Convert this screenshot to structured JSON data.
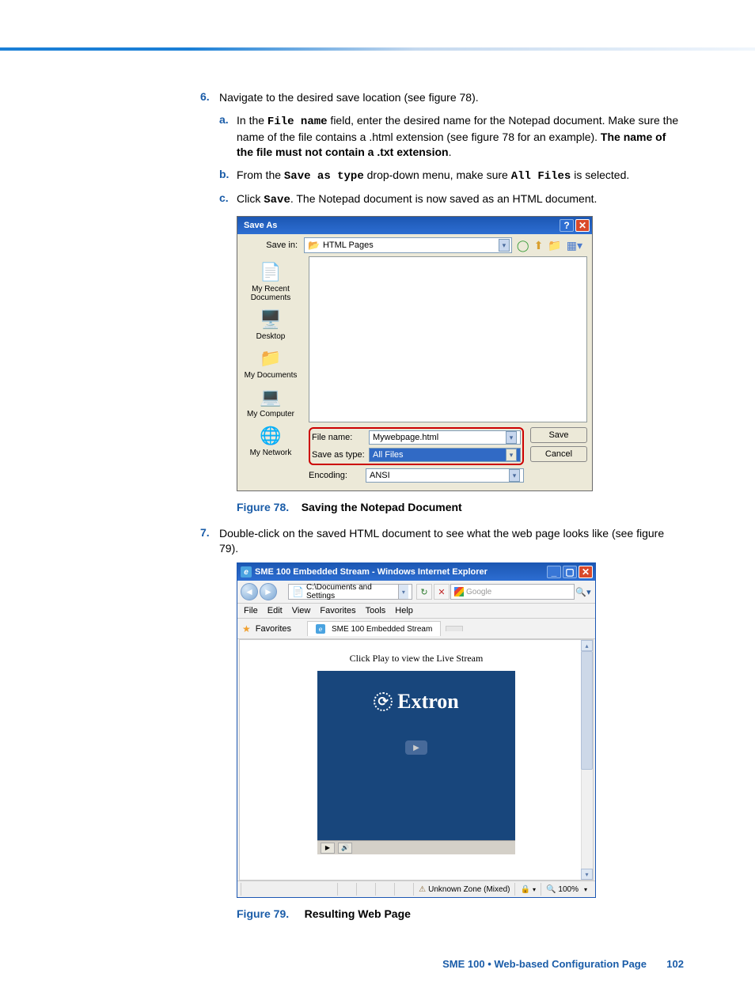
{
  "step6": {
    "num": "6.",
    "text": "Navigate to the desired save location (see figure 78).",
    "a": {
      "marker": "a.",
      "t1": "In the ",
      "code1": "File name",
      "t2": " field, enter the desired name for the Notepad document. Make sure the name of the file contains a .html extension (see figure 78 for an example). ",
      "bold": "The name of the file must not contain a .txt extension",
      "t3": "."
    },
    "b": {
      "marker": "b.",
      "t1": "From the ",
      "code1": "Save as type",
      "t2": " drop-down menu, make sure ",
      "code2": "All Files",
      "t3": " is selected."
    },
    "c": {
      "marker": "c.",
      "t1": "Click ",
      "code1": "Save",
      "t2": ". The Notepad document is now saved as an HTML document."
    }
  },
  "saveas": {
    "title": "Save As",
    "savein_label": "Save in:",
    "savein_value": "HTML Pages",
    "sidebar": [
      "My Recent Documents",
      "Desktop",
      "My Documents",
      "My Computer",
      "My Network"
    ],
    "filename_label": "File name:",
    "filename_value": "Mywebpage.html",
    "saveastype_label": "Save as type:",
    "saveastype_value": "All Files",
    "encoding_label": "Encoding:",
    "encoding_value": "ANSI",
    "save_btn": "Save",
    "cancel_btn": "Cancel"
  },
  "fig78": {
    "num": "Figure 78.",
    "title": "Saving the Notepad Document"
  },
  "step7": {
    "num": "7.",
    "text": "Double-click on the saved HTML document to see what the web page looks like (see figure 79)."
  },
  "ie": {
    "title": "SME 100 Embedded Stream - Windows Internet Explorer",
    "address": "C:\\Documents and Settings",
    "search": "Google",
    "menu": [
      "File",
      "Edit",
      "View",
      "Favorites",
      "Tools",
      "Help"
    ],
    "favorites": "Favorites",
    "tab": "SME 100 Embedded Stream",
    "stream_text": "Click Play to view the Live Stream",
    "brand": "Extron",
    "status_zone": "Unknown Zone (Mixed)",
    "zoom": "100%"
  },
  "fig79": {
    "num": "Figure 79.",
    "title": "Resulting Web Page"
  },
  "footer": {
    "text": "SME 100 • Web-based Configuration Page",
    "page": "102"
  }
}
